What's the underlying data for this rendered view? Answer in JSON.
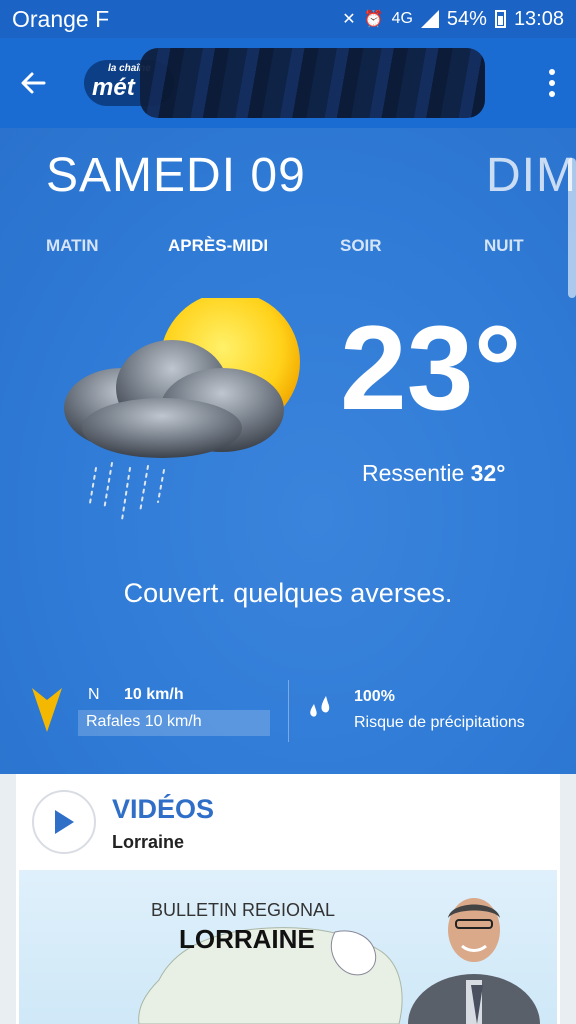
{
  "status_bar": {
    "carrier": "Orange F",
    "network": "4G",
    "battery": "54%",
    "time": "13:08"
  },
  "app_bar": {
    "logo_small": "la chaîne",
    "logo_big": "mét"
  },
  "days": {
    "current": "SAMEDI 09",
    "next": "DIM"
  },
  "periods": [
    {
      "label": "MATIN",
      "active": false
    },
    {
      "label": "APRÈS-MIDI",
      "active": true
    },
    {
      "label": "SOIR",
      "active": false
    },
    {
      "label": "NUIT",
      "active": false
    }
  ],
  "forecast": {
    "icon": "sun-cloud-rain-icon",
    "temperature": "23°",
    "feels_like_label": "Ressentie",
    "feels_like_value": "32°",
    "description": "Couvert. quelques averses."
  },
  "wind": {
    "direction": "N",
    "speed": "10 km/h",
    "gusts": "Rafales 10 km/h"
  },
  "precipitation": {
    "probability": "100%",
    "label": "Risque de précipitations"
  },
  "videos": {
    "title": "VIDÉOS",
    "subtitle": "Lorraine",
    "thumbnail_line1": "BULLETIN REGIONAL",
    "thumbnail_line2": "LORRAINE"
  },
  "colors": {
    "status_bar": "#1b63c4",
    "app_bar": "#1a6cd3",
    "weather_bg": "#2f7bd6",
    "accent": "#2f6fc7",
    "wind_arrow": "#f5b800",
    "sun": "#ffd21a"
  }
}
